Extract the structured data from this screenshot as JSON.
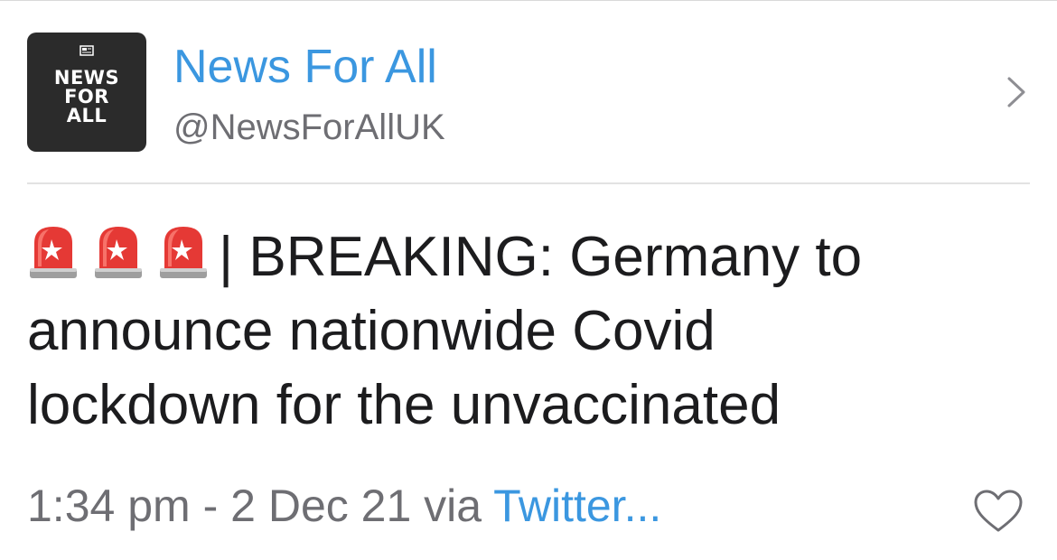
{
  "profile": {
    "avatar_lines": [
      "NEWS",
      "FOR",
      "ALL"
    ],
    "display_name": "News For All",
    "handle": "@NewsForAllUK"
  },
  "tweet": {
    "lead_emoji": "police-car-light-icon",
    "lead_emoji_count": 3,
    "separator": "|",
    "lines": [
      "BREAKING: Germany to",
      "announce nationwide Covid",
      "lockdown for the unvaccinated"
    ]
  },
  "meta": {
    "time": "1:34 pm",
    "dash": "-",
    "date": "2 Dec 21",
    "via_label": "via",
    "via_app": "Twitter..."
  },
  "icons": {
    "chevron": "chevron-right-icon",
    "like": "heart-outline-icon"
  },
  "colors": {
    "link_blue": "#3b97e0",
    "secondary_gray": "#6e6e73",
    "text_dark": "#1c1c1e",
    "siren_red": "#e53935",
    "avatar_bg": "#2b2b2b"
  }
}
